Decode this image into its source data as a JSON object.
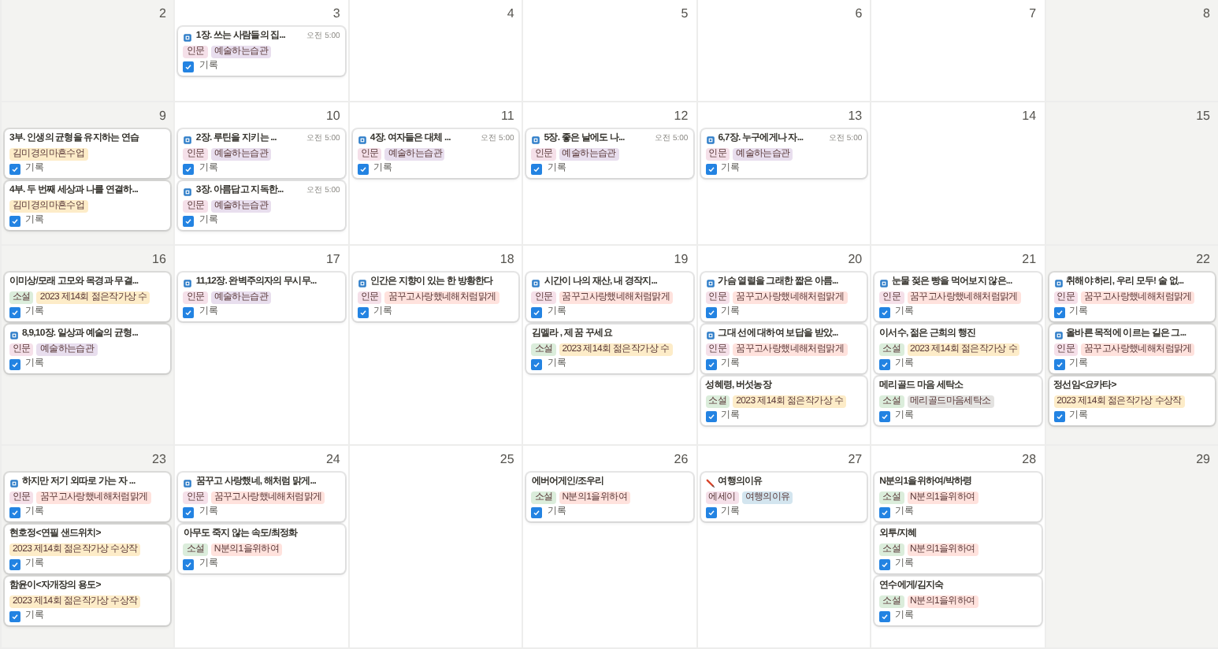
{
  "weeks": [
    {
      "days": [
        {
          "date": "2",
          "weekend": true
        },
        {
          "date": "3",
          "weekend": false,
          "events": [
            {
              "kind": "doc",
              "title": "1장. 쓰는 사람들의 집...",
              "time": "오전 5:00",
              "tags": [
                {
                  "label": "인문",
                  "color": "#f5e0e9"
                },
                {
                  "label": "예술하는습관",
                  "color": "#e8deee"
                }
              ],
              "record": {
                "label": "기록",
                "checked": true
              }
            }
          ]
        },
        {
          "date": "4",
          "weekend": false
        },
        {
          "date": "5",
          "weekend": false
        },
        {
          "date": "6",
          "weekend": false
        },
        {
          "date": "7",
          "weekend": false
        },
        {
          "date": "8",
          "weekend": true
        }
      ]
    },
    {
      "days": [
        {
          "date": "9",
          "weekend": true,
          "events": [
            {
              "kind": "plain",
              "title": "3부. 인생의 균형을 유지하는 연습",
              "tags": [
                {
                  "label": "김미경의마흔수업",
                  "color": "#fdecc8"
                }
              ],
              "record": {
                "label": "기록",
                "checked": true
              }
            },
            {
              "kind": "plain",
              "title": "4부. 두 번째 세상과 나를 연결하...",
              "tags": [
                {
                  "label": "김미경의마흔수업",
                  "color": "#fdecc8"
                }
              ],
              "record": {
                "label": "기록",
                "checked": true
              }
            }
          ]
        },
        {
          "date": "10",
          "weekend": false,
          "events": [
            {
              "kind": "doc",
              "title": "2장. 루틴을 지키는 ...",
              "time": "오전 5:00",
              "tags": [
                {
                  "label": "인문",
                  "color": "#f5e0e9"
                },
                {
                  "label": "예술하는습관",
                  "color": "#e8deee"
                }
              ],
              "record": {
                "label": "기록",
                "checked": true
              }
            },
            {
              "kind": "doc",
              "title": "3장. 아름답고 지독한...",
              "time": "오전 5:00",
              "tags": [
                {
                  "label": "인문",
                  "color": "#f5e0e9"
                },
                {
                  "label": "예술하는습관",
                  "color": "#e8deee"
                }
              ],
              "record": {
                "label": "기록",
                "checked": true
              }
            }
          ]
        },
        {
          "date": "11",
          "weekend": false,
          "events": [
            {
              "kind": "doc",
              "title": "4장. 여자들은 대체 ...",
              "time": "오전 5:00",
              "tags": [
                {
                  "label": "인문",
                  "color": "#f5e0e9"
                },
                {
                  "label": "예술하는습관",
                  "color": "#e8deee"
                }
              ],
              "record": {
                "label": "기록",
                "checked": true
              }
            }
          ]
        },
        {
          "date": "12",
          "weekend": false,
          "events": [
            {
              "kind": "doc",
              "title": "5장. 좋은 날에도 나...",
              "time": "오전 5:00",
              "tags": [
                {
                  "label": "인문",
                  "color": "#f5e0e9"
                },
                {
                  "label": "예술하는습관",
                  "color": "#e8deee"
                }
              ],
              "record": {
                "label": "기록",
                "checked": true
              }
            }
          ]
        },
        {
          "date": "13",
          "weekend": false,
          "events": [
            {
              "kind": "doc",
              "title": "6,7장. 누구에게나 자...",
              "time": "오전 5:00",
              "tags": [
                {
                  "label": "인문",
                  "color": "#f5e0e9"
                },
                {
                  "label": "예술하는습관",
                  "color": "#e8deee"
                }
              ],
              "record": {
                "label": "기록",
                "checked": true
              }
            }
          ]
        },
        {
          "date": "14",
          "weekend": false
        },
        {
          "date": "15",
          "weekend": true
        }
      ]
    },
    {
      "days": [
        {
          "date": "16",
          "weekend": true,
          "events": [
            {
              "kind": "plain",
              "title": "이미상/모래 고모와 목경과 무결...",
              "tags": [
                {
                  "label": "소설",
                  "color": "#dbeddb"
                },
                {
                  "label": "2023 제14회 젊은작가상 수",
                  "color": "#fdecc8"
                }
              ],
              "record": {
                "label": "기록",
                "checked": true
              }
            },
            {
              "kind": "doc",
              "title": "8,9,10장. 일상과 예술의 균형...",
              "tags": [
                {
                  "label": "인문",
                  "color": "#f5e0e9"
                },
                {
                  "label": "예술하는습관",
                  "color": "#e8deee"
                }
              ],
              "record": {
                "label": "기록",
                "checked": true
              }
            }
          ]
        },
        {
          "date": "17",
          "weekend": false,
          "events": [
            {
              "kind": "doc",
              "title": "11,12장. 완벽주의자의 무시무...",
              "tags": [
                {
                  "label": "인문",
                  "color": "#f5e0e9"
                },
                {
                  "label": "예술하는습관",
                  "color": "#e8deee"
                }
              ],
              "record": {
                "label": "기록",
                "checked": true
              }
            }
          ]
        },
        {
          "date": "18",
          "weekend": false,
          "events": [
            {
              "kind": "doc",
              "title": "인간은 지향이 있는 한 방황한다",
              "tags": [
                {
                  "label": "인문",
                  "color": "#f5e0e9"
                },
                {
                  "label": "꿈꾸고사랑했네해처럼맑게",
                  "color": "#ffe2dd"
                }
              ],
              "record": {
                "label": "기록",
                "checked": true
              }
            }
          ]
        },
        {
          "date": "19",
          "weekend": false,
          "events": [
            {
              "kind": "doc",
              "title": "시간이 나의 재산, 내 경작지...",
              "tags": [
                {
                  "label": "인문",
                  "color": "#f5e0e9"
                },
                {
                  "label": "꿈꾸고사랑했네해처럼맑게",
                  "color": "#ffe2dd"
                }
              ],
              "record": {
                "label": "기록",
                "checked": true
              }
            },
            {
              "kind": "plain",
              "title": "김멜라 , 제 꿈 꾸세요",
              "tags": [
                {
                  "label": "소설",
                  "color": "#dbeddb"
                },
                {
                  "label": "2023 제14회 젊은작가상 수",
                  "color": "#fdecc8"
                }
              ],
              "record": {
                "label": "기록",
                "checked": true
              }
            }
          ]
        },
        {
          "date": "20",
          "weekend": false,
          "events": [
            {
              "kind": "doc",
              "title": "가슴 열렬을 그래한 짧은 아름...",
              "tags": [
                {
                  "label": "인문",
                  "color": "#f5e0e9"
                },
                {
                  "label": "꿈꾸고사랑했네해처럼맑게",
                  "color": "#ffe2dd"
                }
              ],
              "record": {
                "label": "기록",
                "checked": true
              }
            },
            {
              "kind": "doc",
              "title": "그대 선에 대하여 보답을 받았...",
              "tags": [
                {
                  "label": "인문",
                  "color": "#f5e0e9"
                },
                {
                  "label": "꿈꾸고사랑했네해처럼맑게",
                  "color": "#ffe2dd"
                }
              ],
              "record": {
                "label": "기록",
                "checked": true
              }
            },
            {
              "kind": "plain",
              "title": "성혜령, 버섯농장",
              "tags": [
                {
                  "label": "소설",
                  "color": "#dbeddb"
                },
                {
                  "label": "2023 제14회 젊은작가상 수",
                  "color": "#fdecc8"
                }
              ],
              "record": {
                "label": "기록",
                "checked": true
              }
            }
          ]
        },
        {
          "date": "21",
          "weekend": false,
          "events": [
            {
              "kind": "doc",
              "title": "눈물 젖은 빵을 먹어보지 않은...",
              "tags": [
                {
                  "label": "인문",
                  "color": "#f5e0e9"
                },
                {
                  "label": "꿈꾸고사랑했네해처럼맑게",
                  "color": "#ffe2dd"
                }
              ],
              "record": {
                "label": "기록",
                "checked": true
              }
            },
            {
              "kind": "plain",
              "title": "이서수, 젊은 근희의 행진",
              "tags": [
                {
                  "label": "소설",
                  "color": "#dbeddb"
                },
                {
                  "label": "2023 제14회 젊은작가상 수",
                  "color": "#fdecc8"
                }
              ],
              "record": {
                "label": "기록",
                "checked": true
              }
            },
            {
              "kind": "plain",
              "title": "메리골드 마음 세탁소",
              "tags": [
                {
                  "label": "소설",
                  "color": "#dbeddb"
                },
                {
                  "label": "메리골드마음세탁소",
                  "color": "#e3e2e0"
                }
              ],
              "record": {
                "label": "기록",
                "checked": true
              }
            }
          ]
        },
        {
          "date": "22",
          "weekend": true,
          "events": [
            {
              "kind": "doc",
              "title": "취해야 하리, 우리 모두! 술 없...",
              "tags": [
                {
                  "label": "인문",
                  "color": "#f5e0e9"
                },
                {
                  "label": "꿈꾸고사랑했네해처럼맑게",
                  "color": "#ffe2dd"
                }
              ],
              "record": {
                "label": "기록",
                "checked": true
              }
            },
            {
              "kind": "doc",
              "title": "올바른 목적에 이르는 길은 그...",
              "tags": [
                {
                  "label": "인문",
                  "color": "#f5e0e9"
                },
                {
                  "label": "꿈꾸고사랑했네해처럼맑게",
                  "color": "#ffe2dd"
                }
              ],
              "record": {
                "label": "기록",
                "checked": true
              }
            },
            {
              "kind": "plain",
              "title": "정선임<요카타>",
              "tags": [
                {
                  "label": "2023 제14회 젊은작가상 수상작",
                  "color": "#fdecc8"
                }
              ],
              "record": {
                "label": "기록",
                "checked": true
              }
            }
          ]
        }
      ]
    },
    {
      "days": [
        {
          "date": "23",
          "weekend": true,
          "events": [
            {
              "kind": "doc",
              "title": "하지만 저기 외따로 가는 자 ...",
              "tags": [
                {
                  "label": "인문",
                  "color": "#f5e0e9"
                },
                {
                  "label": "꿈꾸고사랑했네해처럼맑게",
                  "color": "#ffe2dd"
                }
              ],
              "record": {
                "label": "기록",
                "checked": true
              }
            },
            {
              "kind": "plain",
              "title": "현호정<연필 샌드위치>",
              "tags": [
                {
                  "label": "2023 제14회 젊은작가상 수상작",
                  "color": "#fdecc8"
                }
              ],
              "record": {
                "label": "기록",
                "checked": true
              }
            },
            {
              "kind": "plain",
              "title": "함윤이<자개장의 용도>",
              "tags": [
                {
                  "label": "2023 제14회 젊은작가상 수상작",
                  "color": "#fdecc8"
                }
              ],
              "record": {
                "label": "기록",
                "checked": true
              }
            }
          ]
        },
        {
          "date": "24",
          "weekend": false,
          "events": [
            {
              "kind": "doc",
              "title": "꿈꾸고 사랑했네, 해처럼 맑게...",
              "tags": [
                {
                  "label": "인문",
                  "color": "#f5e0e9"
                },
                {
                  "label": "꿈꾸고사랑했네해처럼맑게",
                  "color": "#ffe2dd"
                }
              ],
              "record": {
                "label": "기록",
                "checked": true
              }
            },
            {
              "kind": "plain",
              "title": "아무도 죽지 않는 속도/최정화",
              "tags": [
                {
                  "label": "소설",
                  "color": "#dbeddb"
                },
                {
                  "label": "N분의1을위하여",
                  "color": "#ffe2dd"
                }
              ],
              "record": {
                "label": "기록",
                "checked": true
              }
            }
          ]
        },
        {
          "date": "25",
          "weekend": false
        },
        {
          "date": "26",
          "weekend": false,
          "events": [
            {
              "kind": "plain",
              "title": "에버어게인/조우리",
              "tags": [
                {
                  "label": "소설",
                  "color": "#dbeddb"
                },
                {
                  "label": "N분의1을위하여",
                  "color": "#ffe2dd"
                }
              ],
              "record": {
                "label": "기록",
                "checked": true
              }
            }
          ]
        },
        {
          "date": "27",
          "weekend": false,
          "events": [
            {
              "kind": "pencil",
              "title": "여행의이유",
              "tags": [
                {
                  "label": "에세이",
                  "color": "#f5e0e9"
                },
                {
                  "label": "여행의이유",
                  "color": "#d3e5ef"
                }
              ],
              "record": {
                "label": "기록",
                "checked": true
              }
            }
          ]
        },
        {
          "date": "28",
          "weekend": false,
          "events": [
            {
              "kind": "plain",
              "title": "N분의1을위하여/박하령",
              "tags": [
                {
                  "label": "소설",
                  "color": "#dbeddb"
                },
                {
                  "label": "N분의1을위하여",
                  "color": "#ffe2dd"
                }
              ],
              "record": {
                "label": "기록",
                "checked": true
              }
            },
            {
              "kind": "plain",
              "title": "외투/지혜",
              "tags": [
                {
                  "label": "소설",
                  "color": "#dbeddb"
                },
                {
                  "label": "N분의1을위하여",
                  "color": "#ffe2dd"
                }
              ],
              "record": {
                "label": "기록",
                "checked": true
              }
            },
            {
              "kind": "plain",
              "title": "연수에게/김지숙",
              "tags": [
                {
                  "label": "소설",
                  "color": "#dbeddb"
                },
                {
                  "label": "N분의1을위하여",
                  "color": "#ffe2dd"
                }
              ],
              "record": {
                "label": "기록",
                "checked": true
              }
            }
          ]
        },
        {
          "date": "29",
          "weekend": true
        }
      ]
    }
  ]
}
